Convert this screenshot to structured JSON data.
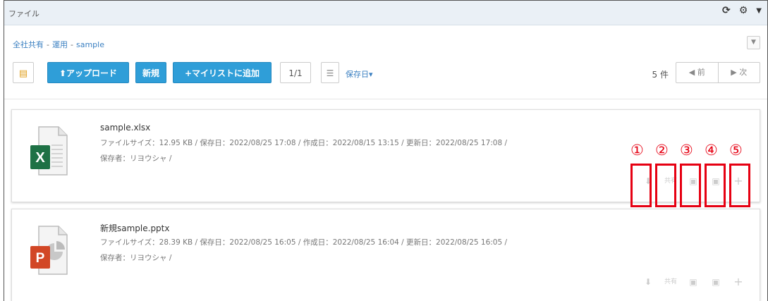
{
  "window": {
    "title": "ファイル",
    "icons": [
      "refresh-icon",
      "gear-icon",
      "caret-down-icon"
    ]
  },
  "breadcrumb": [
    "全社共有",
    "運用",
    "sample"
  ],
  "toolbar": {
    "upload_label": "⬆アップロード",
    "new_label": "新規",
    "add_mylist_label": "+マイリストに追加",
    "page_indicator": "1/1",
    "sort_label": "保存日▾",
    "count": "5 件",
    "prev_label": "◀ 前",
    "next_label": "▶ 次"
  },
  "files": [
    {
      "name": "sample.xlsx",
      "type": "excel",
      "icon_letter": "X",
      "meta": "ファイルサイズ：12.95 KB / 保存日：2022/08/25 17:08 / 作成日：2022/08/15 13:15 / 更新日：2022/08/25 17:08 /",
      "owner": "保存者：リヨウシャ /"
    },
    {
      "name": "新規sample.pptx",
      "type": "powerpoint",
      "icon_letter": "P",
      "meta": "ファイルサイズ：28.39 KB / 保存日：2022/08/25 16:05 / 作成日：2022/08/25 16:04 / 更新日：2022/08/25 16:05 /",
      "owner": "保存者：リヨウシャ /"
    }
  ],
  "actions": {
    "download": "⬇",
    "share": "共有",
    "comment": "▣",
    "edit": "▣",
    "add": "+"
  },
  "annotations": [
    "①",
    "②",
    "③",
    "④",
    "⑤"
  ],
  "colors": {
    "accent_blue": "#2f9ed8",
    "annotation_red": "#e60012",
    "excel_green": "#1e7145",
    "ppt_red": "#d24726"
  }
}
